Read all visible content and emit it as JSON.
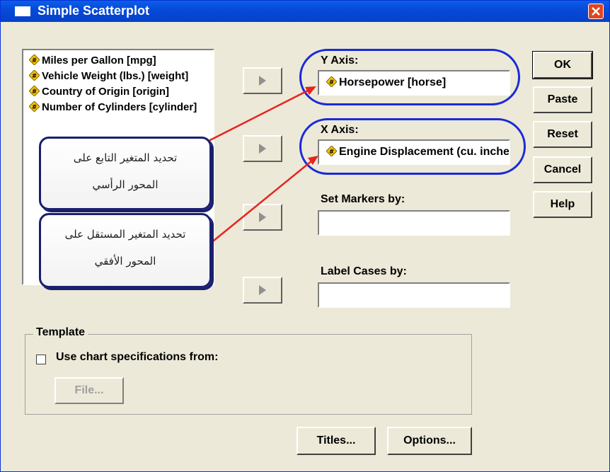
{
  "window": {
    "title": "Simple Scatterplot"
  },
  "variables": [
    {
      "label": "Miles per Gallon [mpg]",
      "icon": "numeric-variable-icon"
    },
    {
      "label": "Vehicle Weight (lbs.) [weight]",
      "icon": "numeric-variable-icon"
    },
    {
      "label": "Country of Origin [origin]",
      "icon": "numeric-variable-icon"
    },
    {
      "label": "Number of Cylinders [cylinder]",
      "icon": "numeric-variable-icon"
    }
  ],
  "fields": {
    "y_axis": {
      "label": "Y Axis:",
      "value": "Horsepower [horse]"
    },
    "x_axis": {
      "label": "X Axis:",
      "value": "Engine Displacement (cu. inches) [engine]"
    },
    "set_markers": {
      "label": "Set Markers by:",
      "value": ""
    },
    "label_cases": {
      "label": "Label Cases by:",
      "value": ""
    }
  },
  "buttons": {
    "ok": "OK",
    "paste": "Paste",
    "reset": "Reset",
    "cancel": "Cancel",
    "help": "Help",
    "file": "File...",
    "titles": "Titles...",
    "options": "Options..."
  },
  "template": {
    "group_label": "Template",
    "checkbox_label": "Use chart specifications from:",
    "checked": false
  },
  "annotations": {
    "dependent": {
      "line1": "تحديد المتغير التابع على",
      "line2": "المحور الرأسي"
    },
    "independent": {
      "line1": "تحديد المتغير المستقل على",
      "line2": "المحور الأفقي"
    }
  },
  "colors": {
    "titlebar": "#0548d8",
    "highlight_ellipse": "#1a2ad8",
    "arrow": "#e8231e",
    "callout_border": "#1a1f6e"
  }
}
